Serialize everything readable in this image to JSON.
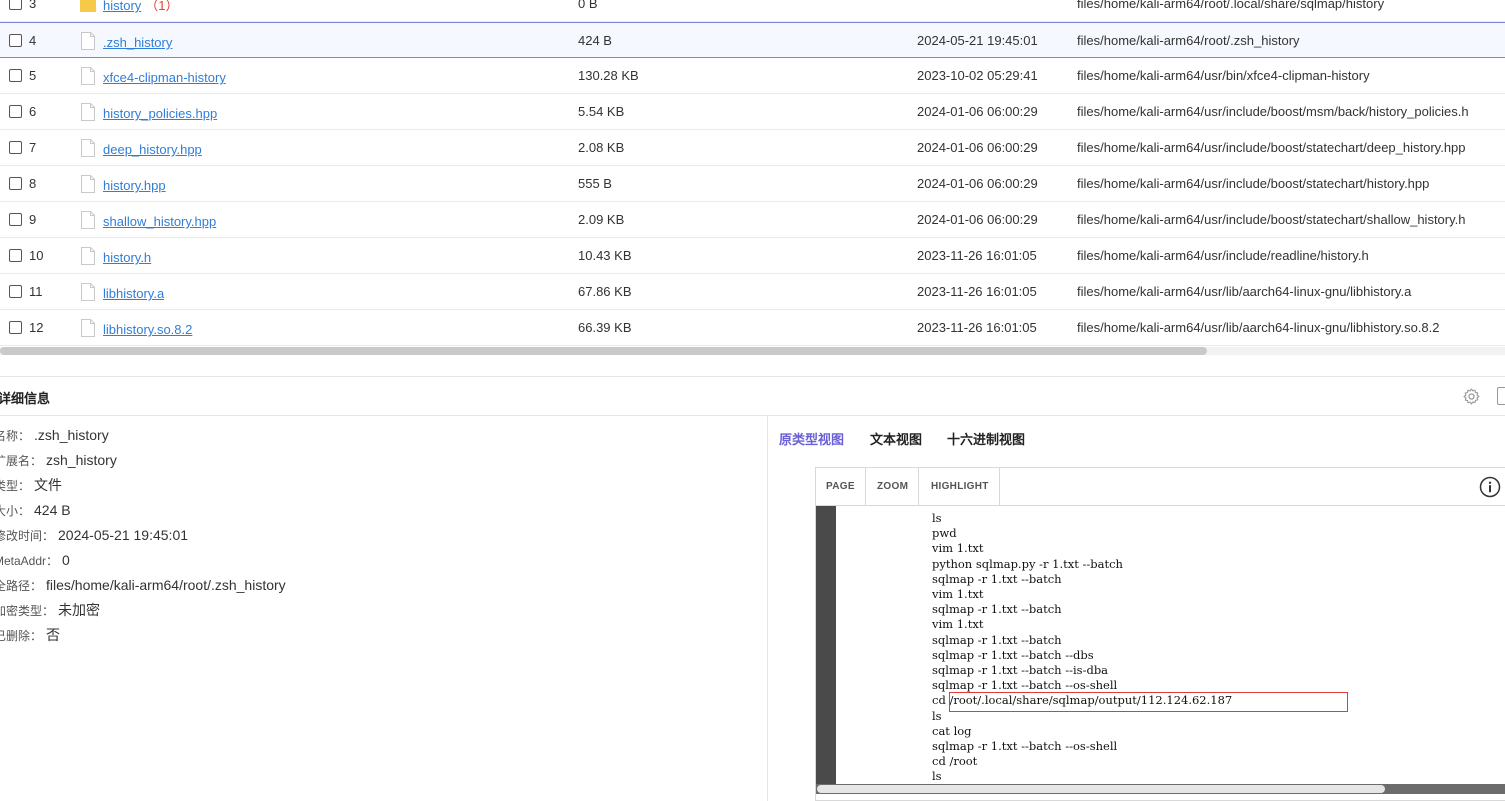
{
  "files": [
    {
      "index": "3",
      "name": "history",
      "count": "（1）",
      "size": "0 B",
      "modified": "",
      "path": "files/home/kali-arm64/root/.local/share/sqlmap/history",
      "type": "folder"
    },
    {
      "index": "4",
      "name": ".zsh_history",
      "count": "",
      "size": "424 B",
      "modified": "2024-05-21 19:45:01",
      "path": "files/home/kali-arm64/root/.zsh_history",
      "type": "file",
      "selected": true
    },
    {
      "index": "5",
      "name": "xfce4-clipman-history",
      "count": "",
      "size": "130.28 KB",
      "modified": "2023-10-02 05:29:41",
      "path": "files/home/kali-arm64/usr/bin/xfce4-clipman-history",
      "type": "file"
    },
    {
      "index": "6",
      "name": "history_policies.hpp",
      "count": "",
      "size": "5.54 KB",
      "modified": "2024-01-06 06:00:29",
      "path": "files/home/kali-arm64/usr/include/boost/msm/back/history_policies.h",
      "type": "file"
    },
    {
      "index": "7",
      "name": "deep_history.hpp",
      "count": "",
      "size": "2.08 KB",
      "modified": "2024-01-06 06:00:29",
      "path": "files/home/kali-arm64/usr/include/boost/statechart/deep_history.hpp",
      "type": "file"
    },
    {
      "index": "8",
      "name": "history.hpp",
      "count": "",
      "size": "555 B",
      "modified": "2024-01-06 06:00:29",
      "path": "files/home/kali-arm64/usr/include/boost/statechart/history.hpp",
      "type": "file"
    },
    {
      "index": "9",
      "name": "shallow_history.hpp",
      "count": "",
      "size": "2.09 KB",
      "modified": "2024-01-06 06:00:29",
      "path": "files/home/kali-arm64/usr/include/boost/statechart/shallow_history.h",
      "type": "file"
    },
    {
      "index": "10",
      "name": "history.h",
      "count": "",
      "size": "10.43 KB",
      "modified": "2023-11-26 16:01:05",
      "path": "files/home/kali-arm64/usr/include/readline/history.h",
      "type": "file"
    },
    {
      "index": "11",
      "name": "libhistory.a",
      "count": "",
      "size": "67.86 KB",
      "modified": "2023-11-26 16:01:05",
      "path": "files/home/kali-arm64/usr/lib/aarch64-linux-gnu/libhistory.a",
      "type": "file"
    },
    {
      "index": "12",
      "name": "libhistory.so.8.2",
      "count": "",
      "size": "66.39 KB",
      "modified": "2023-11-26 16:01:05",
      "path": "files/home/kali-arm64/usr/lib/aarch64-linux-gnu/libhistory.so.8.2",
      "type": "file"
    }
  ],
  "detail": {
    "title": "详细信息",
    "props": [
      {
        "label": "名称：",
        "value": ".zsh_history"
      },
      {
        "label": "扩展名：",
        "value": "zsh_history"
      },
      {
        "label": "类型：",
        "value": "文件"
      },
      {
        "label": "大小：",
        "value": "424 B"
      },
      {
        "label": "修改时间：",
        "value": "2024-05-21 19:45:01"
      },
      {
        "label": "MetaAddr：",
        "value": "0"
      },
      {
        "label": "全路径：",
        "value": "files/home/kali-arm64/root/.zsh_history"
      },
      {
        "label": "加密类型：",
        "value": "未加密"
      },
      {
        "label": "已删除：",
        "value": "否"
      }
    ]
  },
  "viewer": {
    "tabs": [
      "原类型视图",
      "文本视图",
      "十六进制视图"
    ],
    "active_tab": 0,
    "toolbar": [
      "PAGE",
      "ZOOM",
      "HIGHLIGHT"
    ],
    "lines": [
      "ls",
      "pwd",
      "vim 1.txt",
      "python sqlmap.py -r 1.txt --batch",
      "sqlmap -r 1.txt --batch",
      "vim 1.txt",
      "sqlmap -r 1.txt --batch",
      "vim 1.txt",
      "sqlmap -r 1.txt --batch",
      "sqlmap -r 1.txt --batch --dbs",
      "sqlmap -r 1.txt --batch --is-dba",
      "sqlmap -r 1.txt --batch --os-shell",
      "cd /root/.local/share/sqlmap/output/112.124.62.187",
      "ls",
      "cat log",
      "sqlmap -r 1.txt --batch --os-shell",
      "cd /root",
      "ls"
    ],
    "highlighted_line": 12
  },
  "colors": {
    "link": "#2f7ed8",
    "active_tab": "#6b5fd8",
    "highlight_box": "#e23b3b",
    "selected_border": "#7c84d8"
  }
}
